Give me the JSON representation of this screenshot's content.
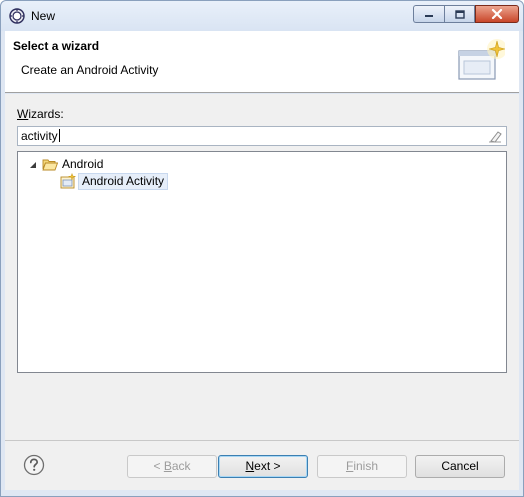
{
  "window": {
    "title": "New"
  },
  "header": {
    "title": "Select a wizard",
    "description": "Create an Android Activity",
    "banner_icon": "wizard-banner-icon"
  },
  "filter": {
    "label_mnemonic": "W",
    "label_rest": "izards:",
    "value": "activity"
  },
  "tree": {
    "items": [
      {
        "label": "Android",
        "icon": "folder-open-icon",
        "expanded": true
      },
      {
        "label": "Android Activity",
        "icon": "android-activity-icon",
        "selected": true
      }
    ]
  },
  "footer": {
    "back": {
      "prefix": "< ",
      "mnemonic": "B",
      "rest": "ack"
    },
    "next": {
      "mnemonic": "N",
      "rest": "ext >"
    },
    "finish": {
      "mnemonic": "F",
      "rest": "inish"
    },
    "cancel": {
      "label": "Cancel"
    }
  }
}
